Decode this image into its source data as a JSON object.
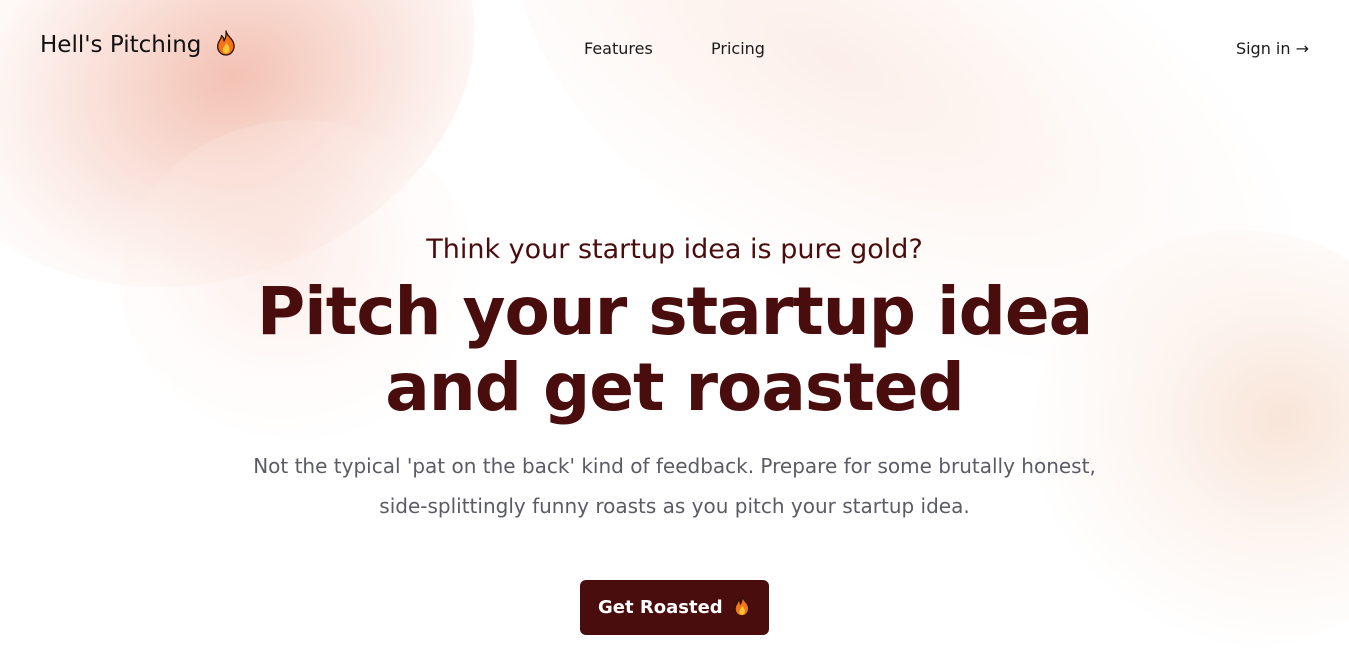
{
  "header": {
    "logo_text": "Hell's Pitching",
    "logo_icon": "flame-icon",
    "nav": [
      {
        "label": "Features"
      },
      {
        "label": "Pricing"
      }
    ],
    "signin_label": "Sign in →"
  },
  "hero": {
    "eyebrow": "Think your startup idea is pure gold?",
    "headline_line1": "Pitch your startup idea",
    "headline_line2": "and get roasted",
    "subtitle": "Not the typical 'pat on the back' kind of feedback. Prepare for some brutally honest, side-splittingly funny roasts as you pitch your startup idea.",
    "cta_label": "Get Roasted",
    "cta_icon": "flame-icon"
  },
  "colors": {
    "brand": "#4a0d0d",
    "text": "#1b1b1b",
    "muted": "#5b5b66",
    "background": "#ffffff",
    "accent_glow": "#f0b2a0"
  }
}
